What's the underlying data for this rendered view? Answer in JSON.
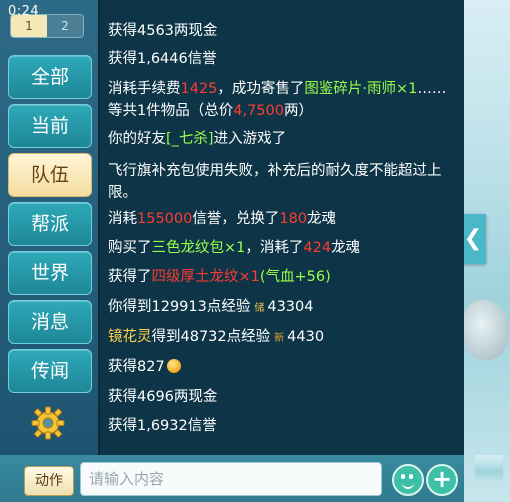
{
  "status_time": "0:24",
  "pager": {
    "page1": "1",
    "page2": "2"
  },
  "sidebar": {
    "items": [
      {
        "label": "全部"
      },
      {
        "label": "当前"
      },
      {
        "label": "队伍"
      },
      {
        "label": "帮派"
      },
      {
        "label": "世界"
      },
      {
        "label": "消息"
      },
      {
        "label": "传闻"
      }
    ],
    "active": "队伍",
    "settings_icon": "gear-icon"
  },
  "messages": {
    "m1": {
      "text": "获得4563两现金"
    },
    "m2": {
      "text": "获得1,6446信誉"
    },
    "m3": {
      "a": "消耗手续费",
      "fee": "1425",
      "b": "，成功寄售了",
      "item": "图鉴碎片·雨师×1",
      "c": "……等共1件物品（总价",
      "price": "4,7500",
      "d": "两）"
    },
    "m4": {
      "a": "你的好友",
      "name": "[_七杀]",
      "b": "进入游戏了"
    },
    "m5": {
      "text": "飞行旗补充包使用失败，补充后的耐久度不能超过上限。"
    },
    "m6": {
      "a": "消耗",
      "cost": "155000",
      "b": "信誉，兑换了",
      "amount": "180",
      "c": "龙魂"
    },
    "m7": {
      "a": "购买了",
      "item": "三色龙纹包×1",
      "b": "，消耗了",
      "cost": "424",
      "c": "龙魂"
    },
    "m8": {
      "a": "获得了",
      "item": "四级厚土龙纹×1",
      "bonus": "(气血+56)"
    },
    "m9": {
      "a": "你得到129913点经验",
      "badge": "储",
      "b": "43304"
    },
    "m10": {
      "name": "镜花灵",
      "a": "得到48732点经验",
      "badge": "新",
      "b": "4430"
    },
    "m11": {
      "text": "获得827"
    },
    "m12": {
      "text": "获得4696两现金"
    },
    "m13": {
      "text": "获得1,6932信誉"
    }
  },
  "bottom": {
    "action_label": "动作",
    "input_placeholder": "请输入内容",
    "emoji_icon": "smiley-icon",
    "plus_icon": "plus-icon"
  },
  "colors": {
    "highlight_red": "#ff3b30",
    "highlight_green": "#9aff4a",
    "active_tab": "#f3dca0",
    "tab": "#2ea9b9"
  }
}
